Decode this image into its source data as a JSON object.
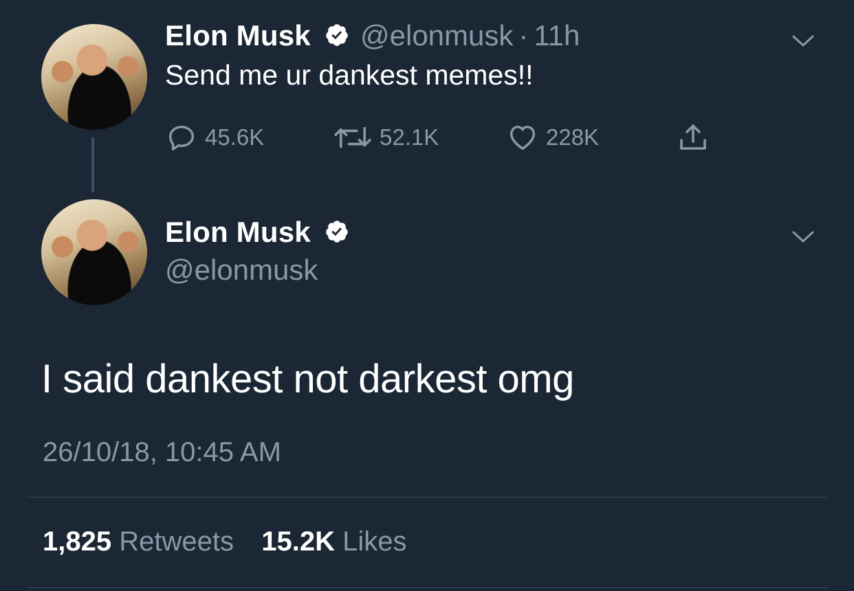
{
  "reply_context": {
    "author": {
      "name": "Elon Musk",
      "handle": "@elonmusk",
      "verified": true,
      "avatar_icon": "profile-photo"
    },
    "separator": "·",
    "age": "11h",
    "text": "Send me ur dankest memes!!",
    "actions": {
      "replies": "45.6K",
      "retweets": "52.1K",
      "likes": "228K"
    }
  },
  "main_tweet": {
    "author": {
      "name": "Elon Musk",
      "handle": "@elonmusk",
      "verified": true,
      "avatar_icon": "profile-photo"
    },
    "text": "I said dankest not darkest omg",
    "timestamp": "26/10/18, 10:45 AM",
    "stats": {
      "retweets_count": "1,825",
      "retweets_label": "Retweets",
      "likes_count": "15.2K",
      "likes_label": "Likes"
    }
  },
  "colors": {
    "background": "#1c2735",
    "muted_text": "#8899a6",
    "divider": "#38444d",
    "thread_line": "#3d4f63"
  },
  "icons": [
    "reply-icon",
    "retweet-icon",
    "like-icon",
    "share-icon",
    "verified-badge-icon",
    "chevron-down-icon"
  ]
}
